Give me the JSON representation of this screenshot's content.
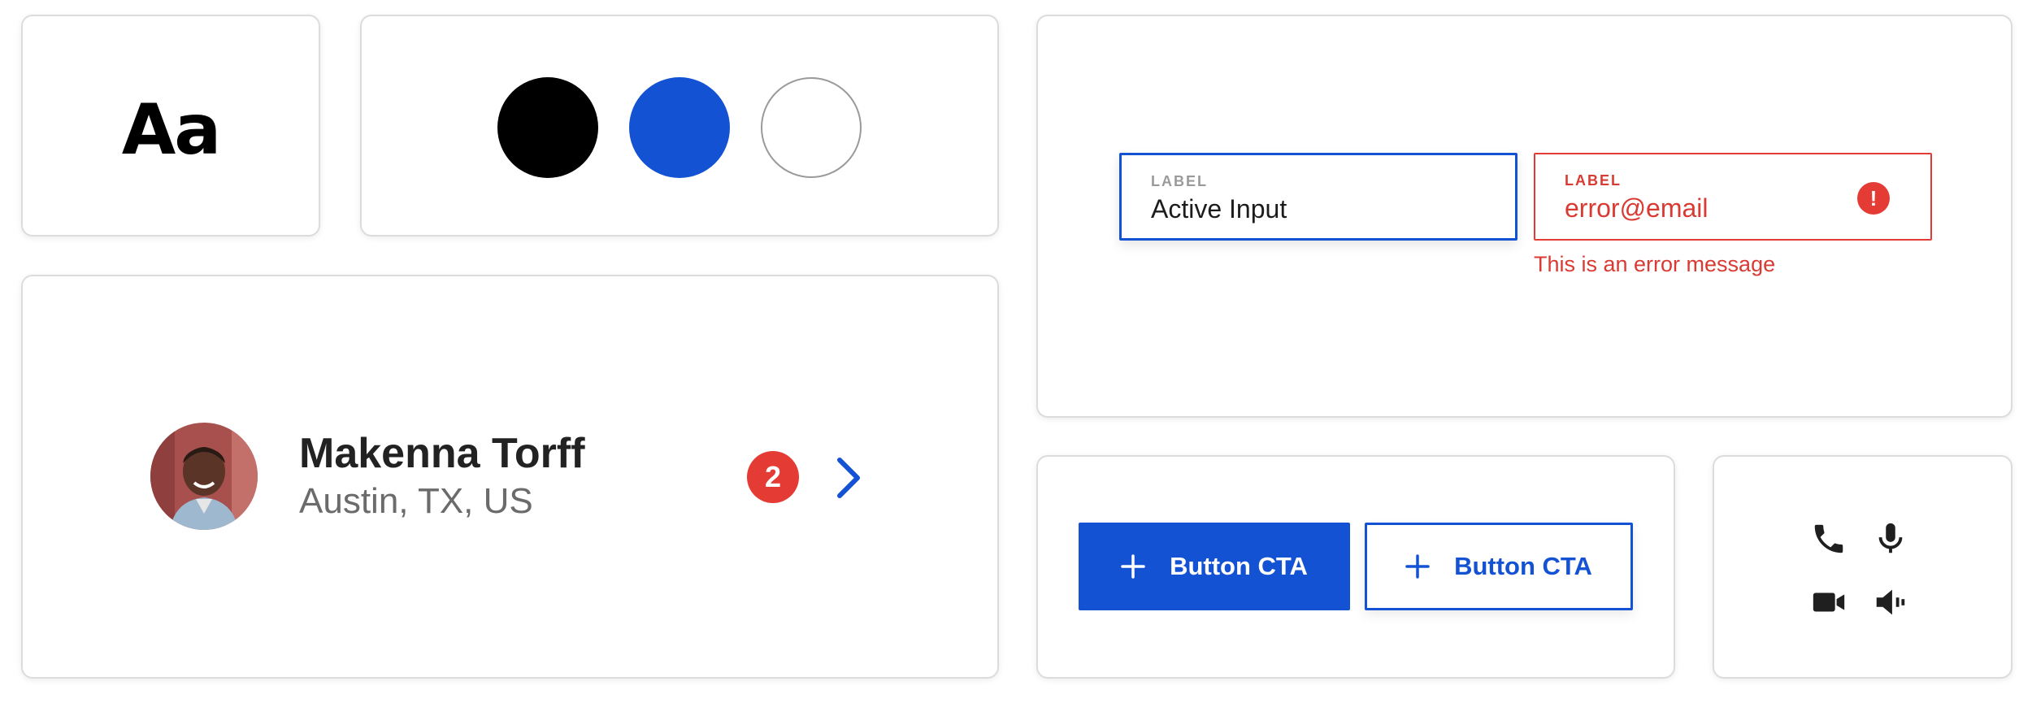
{
  "typography": {
    "sample": "Aa"
  },
  "colors": {
    "swatches": [
      {
        "name": "black",
        "hex": "#000000"
      },
      {
        "name": "blue",
        "hex": "#1452d4"
      },
      {
        "name": "white",
        "hex": "#ffffff"
      }
    ]
  },
  "inputs": {
    "active": {
      "label": "LABEL",
      "value": "Active Input"
    },
    "error": {
      "label": "LABEL",
      "value": "error@email",
      "icon_text": "!",
      "message": "This is an error message"
    }
  },
  "user": {
    "name": "Makenna Torff",
    "location": "Austin, TX, US",
    "badge_count": "2"
  },
  "buttons": {
    "primary_label": "Button CTA",
    "secondary_label": "Button CTA"
  },
  "icons": [
    "phone-icon",
    "microphone-icon",
    "video-camera-icon",
    "speaker-icon"
  ],
  "theme": {
    "accent": "#1452d4",
    "error": "#e53b35"
  }
}
